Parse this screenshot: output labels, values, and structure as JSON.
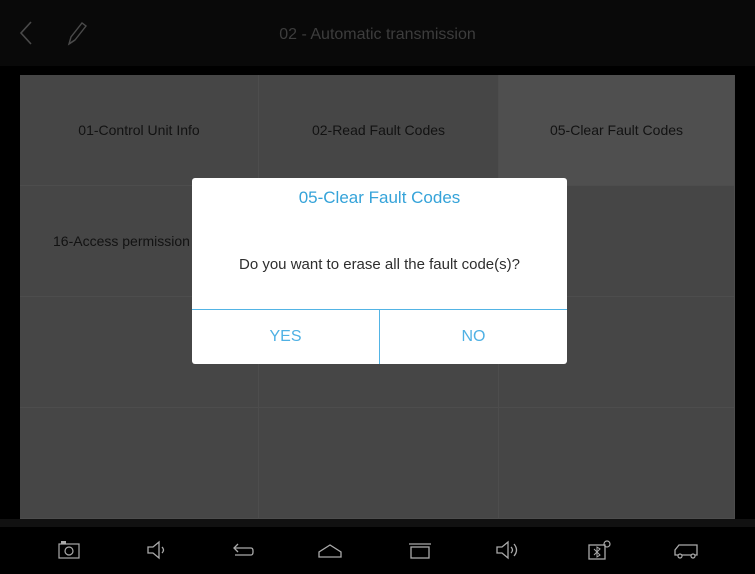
{
  "header": {
    "title": "02 - Automatic transmission",
    "back_icon": "chevron-left-icon",
    "edit_icon": "pencil-icon"
  },
  "menu": {
    "items": [
      {
        "label": "01-Control Unit Info"
      },
      {
        "label": "02-Read Fault Codes"
      },
      {
        "label": "05-Clear Fault Codes"
      },
      {
        "label": "16-Access permission"
      },
      {
        "label": ""
      },
      {
        "label": ""
      },
      {
        "label": ""
      },
      {
        "label": ""
      },
      {
        "label": ""
      },
      {
        "label": ""
      },
      {
        "label": ""
      },
      {
        "label": ""
      }
    ]
  },
  "dialog": {
    "title": "05-Clear Fault Codes",
    "message": "Do you want to erase all the fault code(s)?",
    "yes_label": "YES",
    "no_label": "NO"
  },
  "navbar": {
    "icons": [
      "screenshot-icon",
      "volume-down-icon",
      "back-icon",
      "home-icon",
      "recent-apps-icon",
      "volume-up-icon",
      "vci-connection-icon",
      "vehicle-icon"
    ]
  },
  "colors": {
    "accent": "#35a3d9",
    "background": "#464646"
  }
}
